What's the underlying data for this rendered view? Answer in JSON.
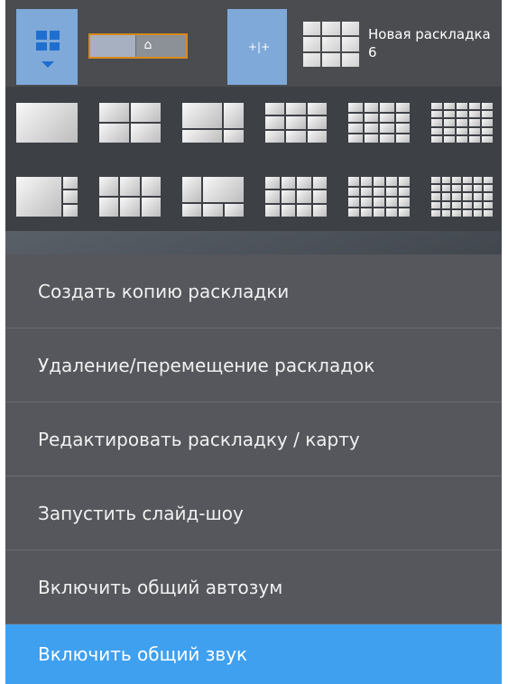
{
  "toolbar": {
    "layouts_button_icon": "grid-icon",
    "collapse_icon": "expand-horizontal-icon",
    "home_icon": "home-icon",
    "current_layout_name": "Новая раскладка 6"
  },
  "menu": {
    "items": [
      {
        "label": "Создать копию раскладки",
        "active": false
      },
      {
        "label": "Удаление/перемещение раскладок",
        "active": false
      },
      {
        "label": "Редактировать раскладку / карту",
        "active": false
      },
      {
        "label": "Запустить слайд-шоу",
        "active": false
      },
      {
        "label": "Включить общий автозум",
        "active": false
      },
      {
        "label": "Включить общий звук",
        "active": true
      }
    ]
  },
  "colors": {
    "accent": "#3fa0f0",
    "toolbar_button": "#7fa9d8",
    "menu_bg": "#55575c",
    "highlight_border": "#d98a1c"
  }
}
